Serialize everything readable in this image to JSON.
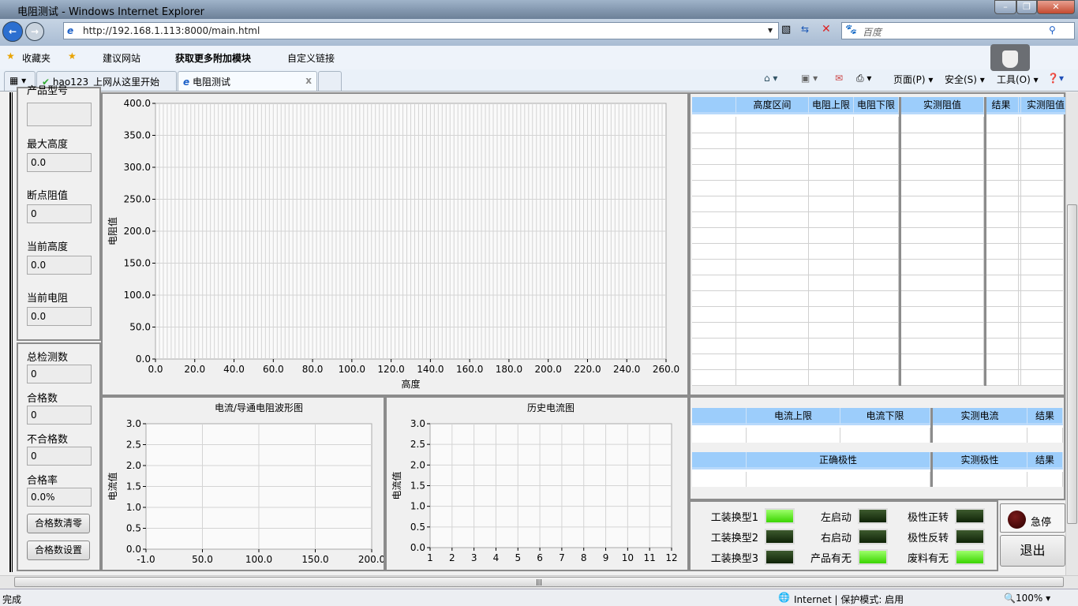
{
  "window": {
    "title": "电阻测试 - Windows Internet Explorer"
  },
  "nav": {
    "url": "http://192.168.1.113:8000/main.html",
    "search_placeholder": "百度"
  },
  "favorites": {
    "label": "收藏夹",
    "items": [
      "建议网站",
      "获取更多附加模块",
      "自定义链接"
    ]
  },
  "tabs": [
    {
      "label": "hao123_上网从这里开始"
    },
    {
      "label": "电阻测试",
      "active": true
    }
  ],
  "commands": [
    "页面(P)",
    "安全(S)",
    "工具(O)"
  ],
  "left_panel": {
    "fields": [
      {
        "label": "产品型号",
        "value": ""
      },
      {
        "label": "最大高度",
        "value": "0.0"
      },
      {
        "label": "断点阻值",
        "value": "0"
      },
      {
        "label": "当前高度",
        "value": "0.0"
      },
      {
        "label": "当前电阻",
        "value": "0.0"
      }
    ],
    "stats": [
      {
        "label": "总检测数",
        "value": "0"
      },
      {
        "label": "合格数",
        "value": "0"
      },
      {
        "label": "不合格数",
        "value": "0"
      },
      {
        "label": "合格率",
        "value": "0.0%"
      }
    ],
    "buttons": {
      "reset": "合格数清零",
      "settings": "合格数设置"
    }
  },
  "chart_data": [
    {
      "type": "line",
      "title": "",
      "xlabel": "高度",
      "ylabel": "电阻值",
      "xlim": [
        0,
        260
      ],
      "ylim": [
        0,
        400
      ],
      "xticks": [
        "0.0",
        "20.0",
        "40.0",
        "60.0",
        "80.0",
        "100.0",
        "120.0",
        "140.0",
        "160.0",
        "180.0",
        "200.0",
        "220.0",
        "240.0",
        "260.0"
      ],
      "yticks": [
        "0.0",
        "50.0",
        "100.0",
        "150.0",
        "200.0",
        "250.0",
        "300.0",
        "350.0",
        "400.0"
      ],
      "series": []
    },
    {
      "type": "line",
      "title": "电流/导通电阻波形图",
      "xlabel": "",
      "ylabel": "电流值",
      "xlim": [
        -1,
        200
      ],
      "ylim": [
        0,
        3
      ],
      "xticks": [
        "-1.0",
        "50.0",
        "100.0",
        "150.0",
        "200.0"
      ],
      "yticks": [
        "0.0",
        "0.5",
        "1.0",
        "1.5",
        "2.0",
        "2.5",
        "3.0"
      ],
      "series": []
    },
    {
      "type": "line",
      "title": "历史电流图",
      "xlabel": "",
      "ylabel": "电流值",
      "xlim": [
        1,
        12
      ],
      "ylim": [
        0,
        3
      ],
      "xticks": [
        "1",
        "2",
        "3",
        "4",
        "5",
        "6",
        "7",
        "8",
        "9",
        "10",
        "11",
        "12"
      ],
      "yticks": [
        "0.0",
        "0.5",
        "1.0",
        "1.5",
        "2.0",
        "2.5",
        "3.0"
      ],
      "series": []
    }
  ],
  "tables": {
    "resistance": {
      "headers": [
        "",
        "高度区间",
        "电阻上限",
        "电阻下限"
      ],
      "measured1": [
        "实测阻值",
        "结果"
      ],
      "measured2": [
        "实测阻值",
        "结果"
      ]
    },
    "current": {
      "headers": [
        "",
        "电流上限",
        "电流下限"
      ],
      "measured": [
        "实测电流",
        "结果"
      ]
    },
    "polarity": {
      "headers": [
        "",
        "正确极性",
        ""
      ],
      "measured": [
        "实测极性",
        "结果"
      ]
    }
  },
  "indicators": [
    {
      "label": "工装换型1",
      "on": true
    },
    {
      "label": "工装换型2",
      "on": false
    },
    {
      "label": "工装换型3",
      "on": false
    },
    {
      "label": "左启动",
      "on": false
    },
    {
      "label": "右启动",
      "on": false
    },
    {
      "label": "产品有无",
      "on": true
    },
    {
      "label": "极性正转",
      "on": false
    },
    {
      "label": "极性反转",
      "on": false
    },
    {
      "label": "废料有无",
      "on": true
    }
  ],
  "estop": {
    "label": "急停"
  },
  "exit": {
    "label": "退出"
  },
  "status": {
    "left": "完成",
    "zone": "Internet | 保护模式: 启用",
    "zoom": "100%"
  }
}
